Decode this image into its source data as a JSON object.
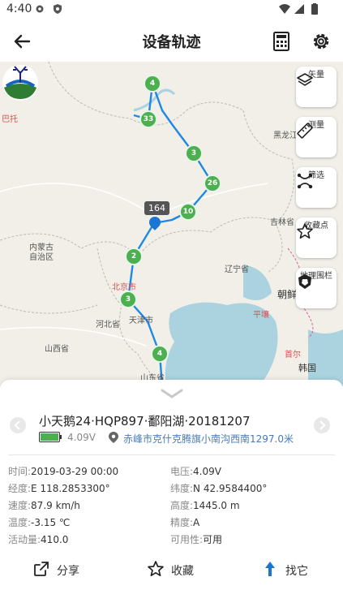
{
  "status_bar": {
    "time": "4:40",
    "icons": [
      "gear-icon",
      "shield-icon",
      "wifi-icon",
      "signal-icon",
      "battery-icon"
    ]
  },
  "header": {
    "title": "设备轨迹",
    "icons": [
      "back-arrow-icon",
      "calculator-icon",
      "gear-icon"
    ]
  },
  "map": {
    "labels": {
      "bieTuo": "巴托",
      "heilongjiang": "黑龙江",
      "jilin": "吉林省",
      "neimenggu": "内蒙古\n自治区",
      "liaoning": "辽宁省",
      "beijing": "北京市",
      "tianjin": "天津市",
      "hebei": "河北省",
      "shanxi": "山西省",
      "shandong": "山东省",
      "chaoxian": "朝鲜",
      "pingrang": "平壤",
      "shouer": "首尔",
      "hanguo": "韩国"
    },
    "markers": [
      "4",
      "33",
      "3",
      "26",
      "10",
      "2",
      "3",
      "4"
    ],
    "current_tag": "164",
    "tools": [
      {
        "label": "矢量",
        "icon": "layers-icon"
      },
      {
        "label": "测量",
        "icon": "ruler-icon"
      },
      {
        "label": "筛选",
        "icon": "filter-nodes-icon"
      },
      {
        "label": "收藏点",
        "icon": "star-icon"
      },
      {
        "label": "地理围栏",
        "icon": "geofence-icon"
      }
    ],
    "track_color": "#1e88e5",
    "marker_color": "#4caf50"
  },
  "sheet": {
    "device_name": "小天鹅24·HQP897·鄱阳湖·20181207",
    "battery_voltage": "4.09V",
    "battery_level": 1.0,
    "location": "赤峰市克什克腾旗小南沟西南1297.0米",
    "info": {
      "time_label": "时间:",
      "time_value": "2019-03-29 00:00",
      "voltage_label": "电压:",
      "voltage_value": "4.09V",
      "lon_label": "经度:",
      "lon_value": "E 118.2853300°",
      "lat_label": "纬度:",
      "lat_value": "N 42.9584400°",
      "speed_label": "速度:",
      "speed_value": "87.9 km/h",
      "alt_label": "高度:",
      "alt_value": "1445.0 m",
      "temp_label": "温度:",
      "temp_value": "-3.15 ℃",
      "acc_label": "精度:",
      "acc_value": "A",
      "activity_label": "活动量:",
      "activity_value": "410.0",
      "avail_label": "可用性:",
      "avail_value": "可用"
    },
    "actions": {
      "share": "分享",
      "favorite": "收藏",
      "find": "找它"
    }
  }
}
